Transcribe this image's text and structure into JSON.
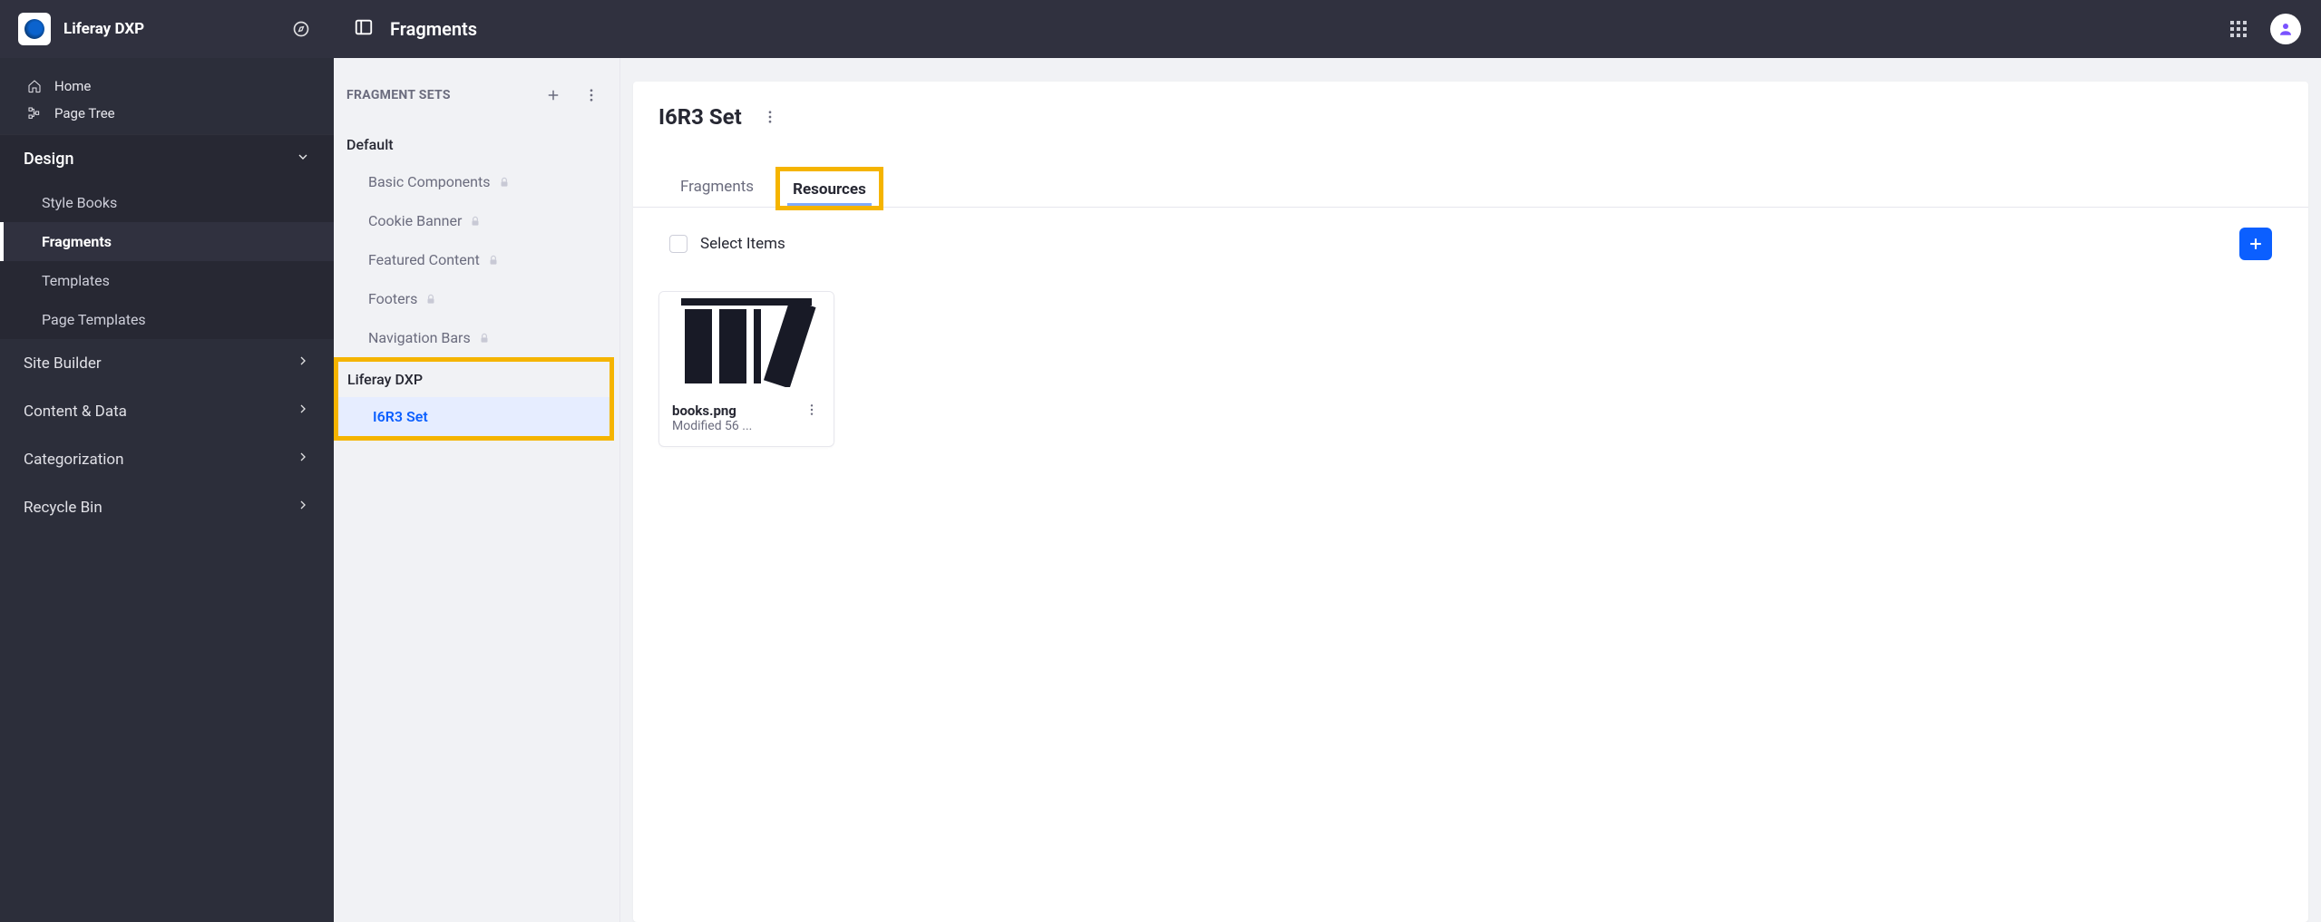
{
  "brand": {
    "title": "Liferay DXP"
  },
  "sidebar": {
    "quicklinks": [
      {
        "label": "Home"
      },
      {
        "label": "Page Tree"
      }
    ],
    "design_label": "Design",
    "design_items": [
      {
        "label": "Style Books"
      },
      {
        "label": "Fragments"
      },
      {
        "label": "Templates"
      },
      {
        "label": "Page Templates"
      }
    ],
    "cats": [
      {
        "label": "Site Builder"
      },
      {
        "label": "Content & Data"
      },
      {
        "label": "Categorization"
      },
      {
        "label": "Recycle Bin"
      }
    ]
  },
  "topbar": {
    "title": "Fragments"
  },
  "sets": {
    "header": "FRAGMENT SETS",
    "groups": [
      {
        "label": "Default",
        "items": [
          {
            "label": "Basic Components",
            "locked": true
          },
          {
            "label": "Cookie Banner",
            "locked": true
          },
          {
            "label": "Featured Content",
            "locked": true
          },
          {
            "label": "Footers",
            "locked": true
          },
          {
            "label": "Navigation Bars",
            "locked": true
          }
        ]
      },
      {
        "label": "Liferay DXP",
        "items": [
          {
            "label": "I6R3 Set",
            "locked": false
          }
        ]
      }
    ]
  },
  "panel": {
    "title": "I6R3 Set",
    "tabs": [
      {
        "label": "Fragments"
      },
      {
        "label": "Resources"
      }
    ],
    "select_label": "Select Items",
    "cards": [
      {
        "title": "books.png",
        "sub": "Modified 56 ..."
      }
    ]
  }
}
